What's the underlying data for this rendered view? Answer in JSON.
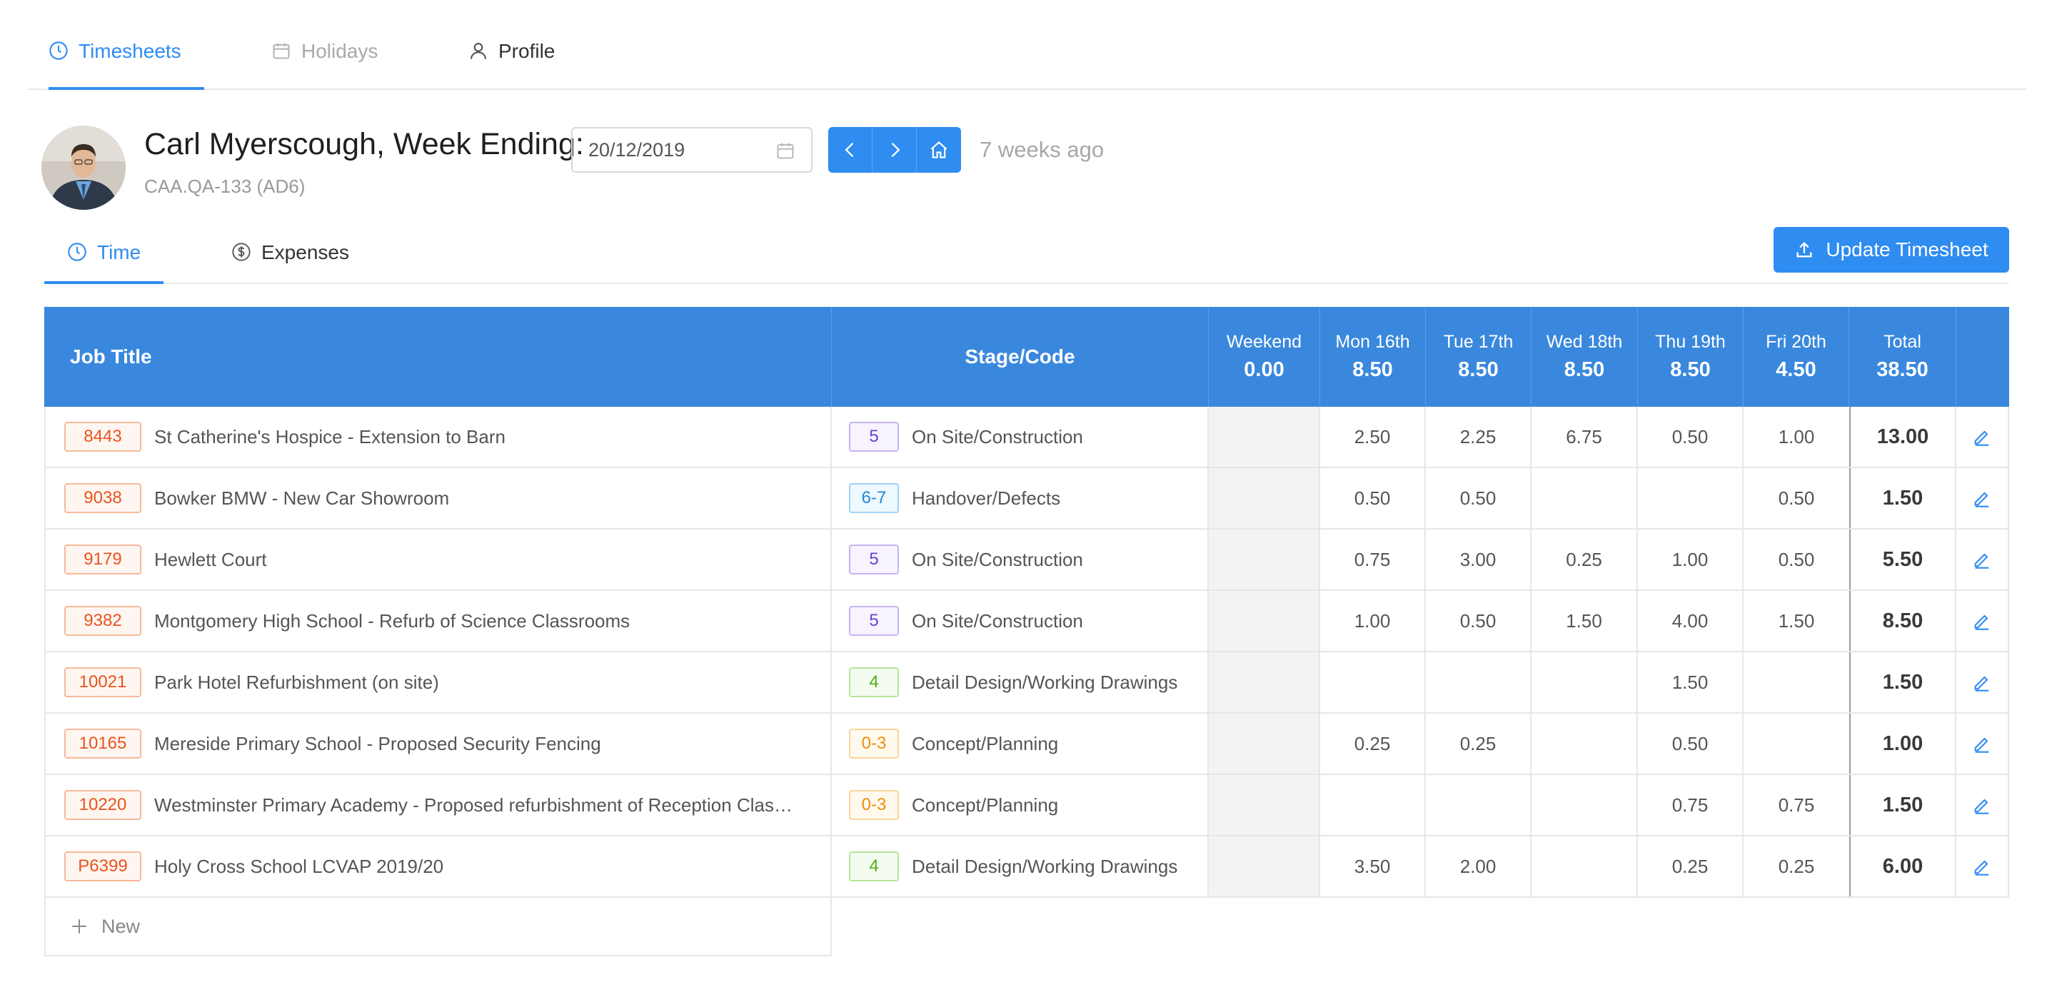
{
  "top_tabs": [
    {
      "label": "Timesheets",
      "icon": "clock-icon",
      "state": "active"
    },
    {
      "label": "Holidays",
      "icon": "calendar-icon",
      "state": "disabled"
    },
    {
      "label": "Profile",
      "icon": "user-icon",
      "state": "normal"
    }
  ],
  "header": {
    "title": "Carl Myerscough, Week Ending:",
    "code": "CAA.QA-133 (AD6)",
    "week_ending_date": "20/12/2019",
    "relative_time": "7 weeks ago"
  },
  "sub_tabs": [
    {
      "label": "Time",
      "icon": "clock-icon",
      "state": "active"
    },
    {
      "label": "Expenses",
      "icon": "dollar-icon",
      "state": "normal"
    }
  ],
  "update_button_label": "Update Timesheet",
  "table": {
    "headers": {
      "job_title": "Job Title",
      "stage_code": "Stage/Code",
      "days": [
        {
          "label": "Weekend",
          "value": "0.00"
        },
        {
          "label": "Mon 16th",
          "value": "8.50"
        },
        {
          "label": "Tue 17th",
          "value": "8.50"
        },
        {
          "label": "Wed 18th",
          "value": "8.50"
        },
        {
          "label": "Thu 19th",
          "value": "8.50"
        },
        {
          "label": "Fri 20th",
          "value": "4.50"
        }
      ],
      "total": {
        "label": "Total",
        "value": "38.50"
      }
    },
    "rows": [
      {
        "job": "8443",
        "title": "St Catherine's Hospice - Extension to Barn",
        "stage": "5",
        "stage_color": "purple",
        "stage_name": "On Site/Construction",
        "hours": [
          "",
          "2.50",
          "2.25",
          "6.75",
          "0.50",
          "1.00"
        ],
        "total": "13.00"
      },
      {
        "job": "9038",
        "title": "Bowker BMW - New Car Showroom",
        "stage": "6-7",
        "stage_color": "blue",
        "stage_name": "Handover/Defects",
        "hours": [
          "",
          "0.50",
          "0.50",
          "",
          "",
          "0.50"
        ],
        "total": "1.50"
      },
      {
        "job": "9179",
        "title": "Hewlett Court",
        "stage": "5",
        "stage_color": "purple",
        "stage_name": "On Site/Construction",
        "hours": [
          "",
          "0.75",
          "3.00",
          "0.25",
          "1.00",
          "0.50"
        ],
        "total": "5.50"
      },
      {
        "job": "9382",
        "title": "Montgomery High School - Refurb of Science Classrooms",
        "stage": "5",
        "stage_color": "purple",
        "stage_name": "On Site/Construction",
        "hours": [
          "",
          "1.00",
          "0.50",
          "1.50",
          "4.00",
          "1.50"
        ],
        "total": "8.50"
      },
      {
        "job": "10021",
        "title": "Park Hotel Refurbishment (on site)",
        "stage": "4",
        "stage_color": "green",
        "stage_name": "Detail Design/Working Drawings",
        "hours": [
          "",
          "",
          "",
          "",
          "1.50",
          ""
        ],
        "total": "1.50"
      },
      {
        "job": "10165",
        "title": "Mereside Primary School - Proposed Security Fencing",
        "stage": "0-3",
        "stage_color": "orange",
        "stage_name": "Concept/Planning",
        "hours": [
          "",
          "0.25",
          "0.25",
          "",
          "0.50",
          ""
        ],
        "total": "1.00"
      },
      {
        "job": "10220",
        "title": "Westminster Primary Academy - Proposed refurbishment of Reception Class …",
        "stage": "0-3",
        "stage_color": "orange",
        "stage_name": "Concept/Planning",
        "hours": [
          "",
          "",
          "",
          "",
          "0.75",
          "0.75"
        ],
        "total": "1.50"
      },
      {
        "job": "P6399",
        "title": "Holy Cross School LCVAP 2019/20",
        "stage": "4",
        "stage_color": "green",
        "stage_name": "Detail Design/Working Drawings",
        "hours": [
          "",
          "3.50",
          "2.00",
          "",
          "0.25",
          "0.25"
        ],
        "total": "6.00"
      }
    ],
    "new_label": "New"
  },
  "colors": {
    "accent": "#2f8cf0",
    "table_header": "#3a88dd",
    "job_badge": "#e8541d"
  }
}
